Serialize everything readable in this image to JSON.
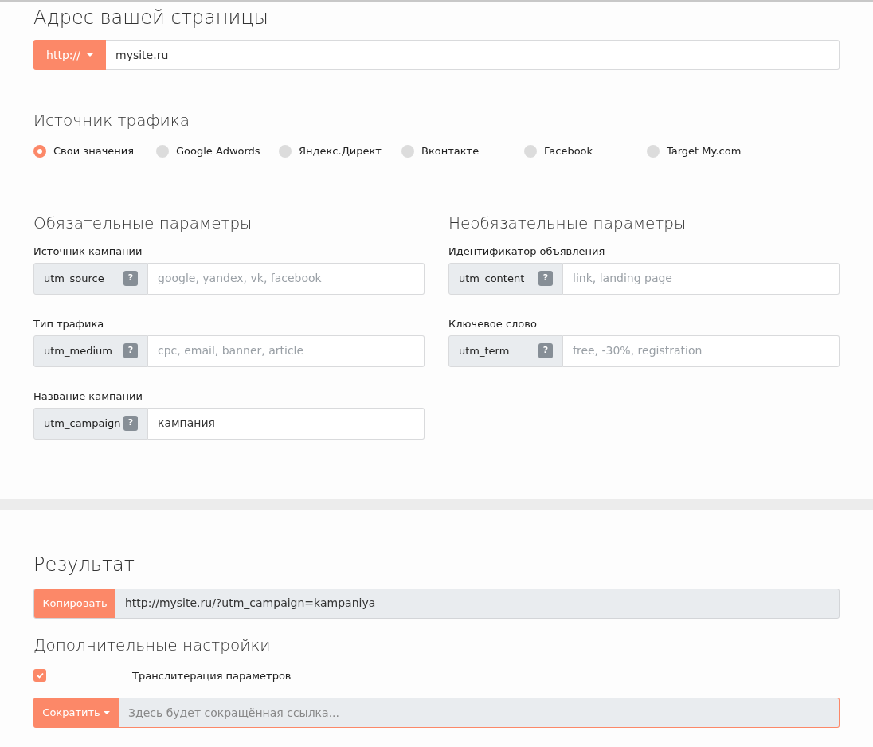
{
  "address": {
    "title": "Адрес вашей страницы",
    "protocol": "http://",
    "value": "mysite.ru"
  },
  "traffic_source": {
    "title": "Источник трафика",
    "options": [
      {
        "label": "Свои значения",
        "selected": true
      },
      {
        "label": "Google Adwords",
        "selected": false
      },
      {
        "label": "Яндекс.Директ",
        "selected": false
      },
      {
        "label": "Вконтакте",
        "selected": false
      },
      {
        "label": "Facebook",
        "selected": false
      },
      {
        "label": "Target My.com",
        "selected": false
      }
    ]
  },
  "required": {
    "title": "Обязательные параметры",
    "fields": [
      {
        "label": "Источник кампании",
        "param": "utm_source",
        "help": "?",
        "placeholder": "google, yandex, vk, facebook"
      },
      {
        "label": "Тип трафика",
        "param": "utm_medium",
        "help": "?",
        "placeholder": "cpc, email, banner, article"
      },
      {
        "label": "Название кампании",
        "param": "utm_campaign",
        "help": "?",
        "value": "кампания"
      }
    ]
  },
  "optional": {
    "title": "Необязательные параметры",
    "fields": [
      {
        "label": "Идентификатор объявления",
        "param": "utm_content",
        "help": "?",
        "placeholder": "link, landing page"
      },
      {
        "label": "Ключевое слово",
        "param": "utm_term",
        "help": "?",
        "placeholder": "free, -30%, registration"
      }
    ]
  },
  "result": {
    "title": "Результат",
    "copy_button": "Копировать",
    "url": "http://mysite.ru/?utm_campaign=kampaniya"
  },
  "extra": {
    "title": "Дополнительные настройки",
    "transliteration": {
      "label": "Транслитерация параметров",
      "checked": true
    },
    "shorten_button": "Сократить",
    "short_placeholder": "Здесь будет сокращённая ссылка..."
  }
}
